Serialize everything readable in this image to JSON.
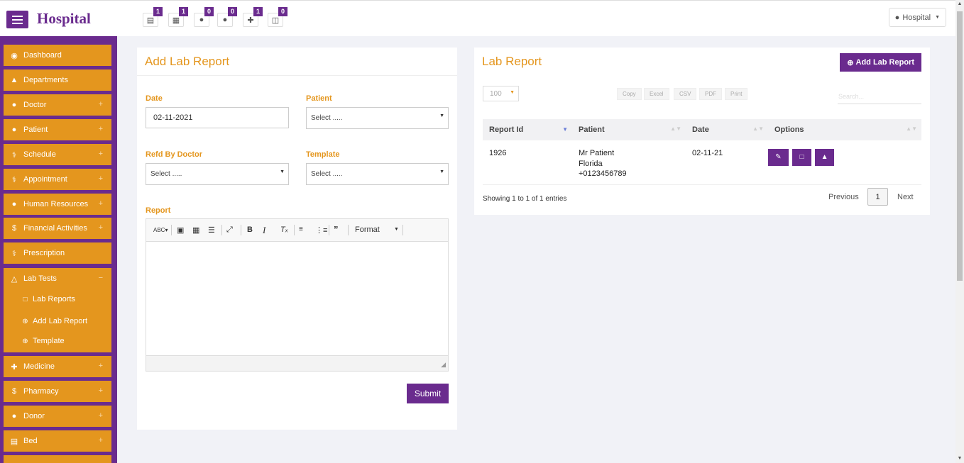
{
  "header": {
    "brand": "Hospital",
    "user_label": "Hospital",
    "notifications": [
      {
        "icon": "bed-icon",
        "count": "1"
      },
      {
        "icon": "money-icon",
        "count": "1"
      },
      {
        "icon": "user-icon",
        "count": "0"
      },
      {
        "icon": "user-icon",
        "count": "0"
      },
      {
        "icon": "medkit-icon",
        "count": "1"
      },
      {
        "icon": "clipboard-icon",
        "count": "0"
      }
    ]
  },
  "sidebar": {
    "items": [
      {
        "label": "Dashboard",
        "icon": "dashboard-icon",
        "expandable": false
      },
      {
        "label": "Departments",
        "icon": "sitemap-icon",
        "expandable": false
      },
      {
        "label": "Doctor",
        "icon": "users-icon",
        "expandable": true
      },
      {
        "label": "Patient",
        "icon": "users-icon",
        "expandable": true
      },
      {
        "label": "Schedule",
        "icon": "stethoscope-icon",
        "expandable": true
      },
      {
        "label": "Appointment",
        "icon": "stethoscope-icon",
        "expandable": true
      },
      {
        "label": "Human Resources",
        "icon": "users-icon",
        "expandable": true
      },
      {
        "label": "Financial Activities",
        "icon": "dollar-icon",
        "expandable": true
      },
      {
        "label": "Prescription",
        "icon": "stethoscope-icon",
        "expandable": false
      }
    ],
    "lab_tests": {
      "label": "Lab Tests",
      "icon": "flask-icon",
      "sub_items": [
        {
          "label": "Lab Reports",
          "icon": "file-icon"
        },
        {
          "label": "Add Lab Report",
          "icon": "plus-circle-icon"
        },
        {
          "label": "Template",
          "icon": "plus-circle-icon"
        }
      ]
    },
    "items_after": [
      {
        "label": "Medicine",
        "icon": "medkit-icon",
        "expandable": true
      },
      {
        "label": "Pharmacy",
        "icon": "dollar-icon",
        "expandable": true
      },
      {
        "label": "Donor",
        "icon": "user-icon",
        "expandable": true
      },
      {
        "label": "Bed",
        "icon": "bed-icon",
        "expandable": true
      }
    ],
    "plus_sign": "+",
    "minus_sign": "−"
  },
  "add_form": {
    "title": "Add Lab Report",
    "date_label": "Date",
    "date_value": "02-11-2021",
    "patient_label": "Patient",
    "patient_value": "Select .....",
    "refd_label": "Refd By Doctor",
    "refd_value": "Select .....",
    "template_label": "Template",
    "template_value": "Select .....",
    "report_label": "Report",
    "editor_format": "Format",
    "submit_label": "Submit"
  },
  "lab_list": {
    "title": "Lab Report",
    "add_button": "Add Lab Report",
    "page_length": "100",
    "export_buttons": [
      "Copy",
      "Excel",
      "CSV",
      "PDF",
      "Print"
    ],
    "search_placeholder": "Search...",
    "columns": [
      "Report Id",
      "Patient",
      "Date",
      "Options"
    ],
    "rows": [
      {
        "id": "1926",
        "patient_name": "Mr Patient",
        "patient_city": "Florida",
        "patient_phone": "+0123456789",
        "date": "02-11-21"
      }
    ],
    "info": "Showing 1 to 1 of 1 entries",
    "prev": "Previous",
    "page": "1",
    "next": "Next"
  },
  "colors": {
    "primary": "#6a2b8e",
    "accent": "#e4961e"
  }
}
